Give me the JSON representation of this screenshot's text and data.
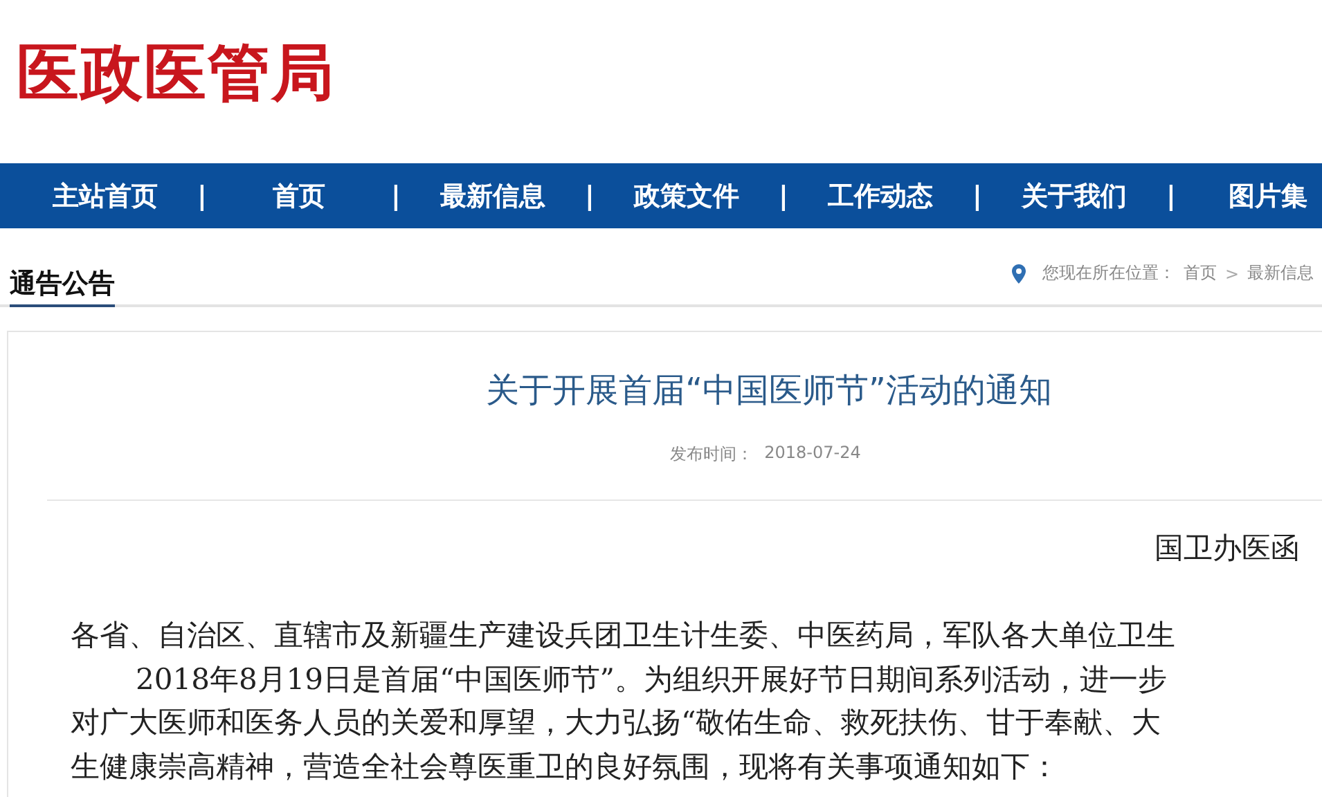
{
  "logo": {
    "title": "医政医管局"
  },
  "nav": [
    {
      "label": "主站首页"
    },
    {
      "label": "首页"
    },
    {
      "label": "最新信息"
    },
    {
      "label": "政策文件"
    },
    {
      "label": "工作动态"
    },
    {
      "label": "关于我们"
    },
    {
      "label": "图片集"
    }
  ],
  "nav_separator": "|",
  "section": {
    "title": "通告公告"
  },
  "breadcrumb": {
    "prefix": "您现在所在位置：",
    "items": [
      "首页",
      "最新信息"
    ],
    "separator": ">"
  },
  "article": {
    "title": "关于开展首届“中国医师节”活动的通知",
    "date_label": "发布时间：",
    "date": "2018-07-24",
    "doc_number": "国卫办医函",
    "paragraphs": [
      {
        "indent": false,
        "lines": [
          "各省、自治区、直辖市及新疆生产建设兵团卫生计生委、中医药局，军队各大单位卫生"
        ]
      },
      {
        "indent": true,
        "lines": [
          "2018年8月19日是首届“中国医师节”。为组织开展好节日期间系列活动，进一步",
          "对广大医师和医务人员的关爱和厚望，大力弘扬“敬佑生命、救死扶伤、甘于奉献、大",
          "生健康崇高精神，营造全社会尊医重卫的良好氛围，现将有关事项通知如下："
        ]
      }
    ]
  }
}
